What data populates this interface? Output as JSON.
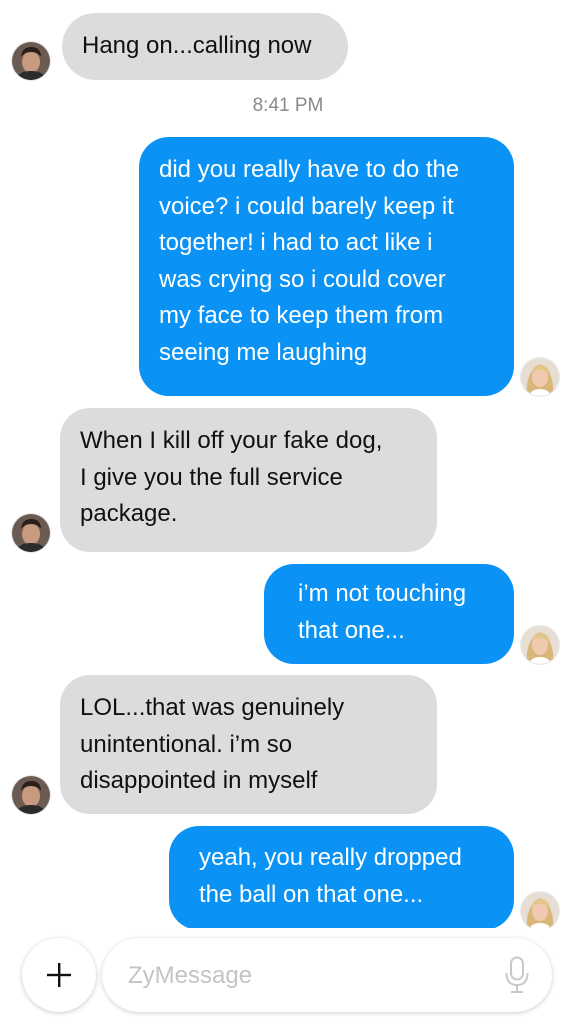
{
  "messages": [
    {
      "direction": "in",
      "text": "Hang on...calling now"
    },
    {
      "direction": "out",
      "text": "did you really have to do the\nvoice? i could barely keep it\ntogether! i had to act like i\nwas crying so i could cover\nmy face to keep them from\nseeing me laughing"
    },
    {
      "direction": "in",
      "text": "When I kill off your fake dog,\nI give you the full service\npackage."
    },
    {
      "direction": "out",
      "text": "i’m not touching\nthat one..."
    },
    {
      "direction": "in",
      "text": "LOL...that was genuinely\nunintentional. i’m so\ndisappointed in myself"
    },
    {
      "direction": "out",
      "text": "yeah, you really dropped\nthe ball on that one..."
    }
  ],
  "timestamp": "8:41 PM",
  "composer": {
    "placeholder": "ZyMessage",
    "add_icon": "plus-icon",
    "mic_icon": "microphone-icon"
  },
  "colors": {
    "incoming_bubble": "#dcdcdc",
    "outgoing_bubble": "#0a93f5",
    "timestamp": "#8a8a8a"
  }
}
